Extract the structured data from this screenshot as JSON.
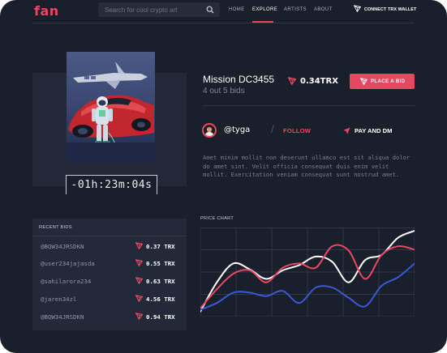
{
  "header": {
    "logo": "fan",
    "search_placeholder": "Search for cool crypto art",
    "nav": [
      "HOME",
      "EXPLORE",
      "ARTISTS",
      "ABOUT"
    ],
    "active_nav": "EXPLORE",
    "wallet_label": "CONNECT TRX WALLET"
  },
  "timer": "-01h:23m:04s",
  "item": {
    "title": "Mission DC3455",
    "bids_label": "4 out 5 bids",
    "price": "0.34TRX",
    "place_bid_label": "PLACE A BID"
  },
  "artist": {
    "handle": "@tyga",
    "follow_label": "FOLLOW",
    "pay_label": "PAY AND DM"
  },
  "description": "Amet minim mollit non deserunt ullamco est sit aliqua dolor do amet sint. Velit officia consequat duis enim velit mollit. Exercitation veniam consequat sunt nostrud amet.",
  "recent_bids": {
    "title": "RECENT BIDS",
    "rows": [
      {
        "user": "@BQW34JRSDKN",
        "amount": "0.37 TRX"
      },
      {
        "user": "@user234jajasda",
        "amount": "0.55 TRX"
      },
      {
        "user": "@sahilarora234",
        "amount": "0.63 TRX"
      },
      {
        "user": "@jaren34zl",
        "amount": "4.56 TRX"
      },
      {
        "user": "@BQW34JRSDKN",
        "amount": "0.94 TRX"
      }
    ]
  },
  "price_chart": {
    "title": "PRICE CHART",
    "colors": {
      "white": "#ffffff",
      "red": "#e8485f",
      "blue": "#3a58d6",
      "grid": "#2f3646"
    },
    "series": [
      {
        "color": "white",
        "values": [
          4,
          38,
          60,
          53,
          42,
          52,
          58,
          68,
          62,
          38,
          64,
          70,
          90,
          98
        ]
      },
      {
        "color": "red",
        "values": [
          8,
          30,
          48,
          52,
          38,
          55,
          60,
          55,
          80,
          75,
          42,
          70,
          80,
          76
        ]
      },
      {
        "color": "blue",
        "values": [
          6,
          14,
          26,
          26,
          22,
          28,
          14,
          32,
          32,
          20,
          10,
          34,
          44,
          60
        ]
      }
    ]
  }
}
